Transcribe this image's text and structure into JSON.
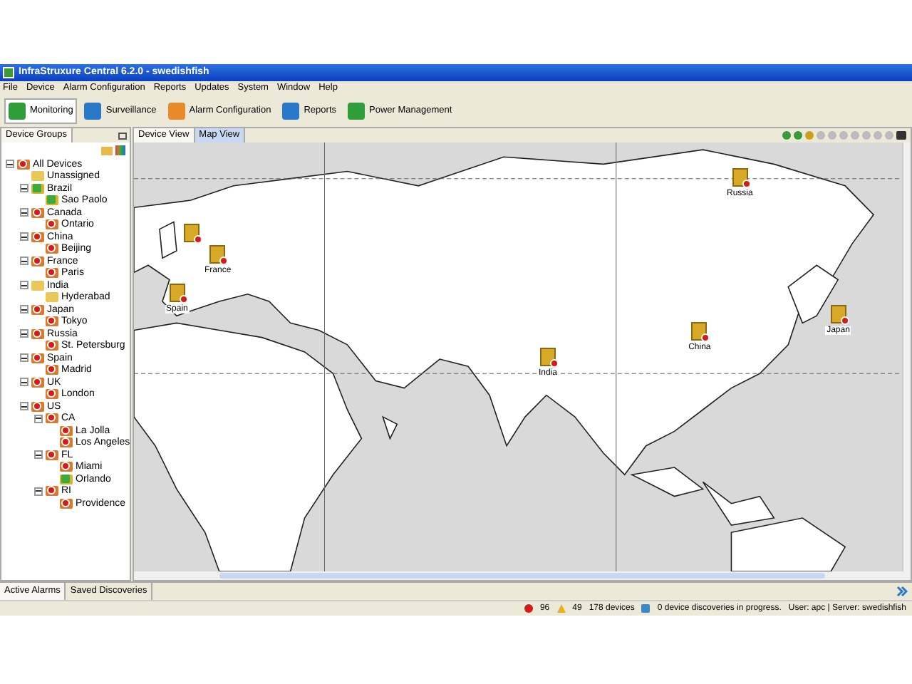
{
  "window": {
    "title": "InfraStruxure Central 6.2.0 - swedishfish"
  },
  "menu": [
    "File",
    "Device",
    "Alarm Configuration",
    "Reports",
    "Updates",
    "System",
    "Window",
    "Help"
  ],
  "toolbar": [
    {
      "label": "Monitoring",
      "selected": true
    },
    {
      "label": "Surveillance",
      "selected": false
    },
    {
      "label": "Alarm Configuration",
      "selected": false
    },
    {
      "label": "Reports",
      "selected": false
    },
    {
      "label": "Power Management",
      "selected": false
    }
  ],
  "left_panel": {
    "tab": "Device Groups",
    "tree": [
      {
        "label": "All Devices",
        "kind": "alarm",
        "expanded": true,
        "children": [
          {
            "label": "Unassigned",
            "kind": "plain"
          },
          {
            "label": "Brazil",
            "kind": "ok",
            "expanded": true,
            "children": [
              {
                "label": "Sao Paolo",
                "kind": "ok"
              }
            ]
          },
          {
            "label": "Canada",
            "kind": "alarm",
            "expanded": true,
            "children": [
              {
                "label": "Ontario",
                "kind": "alarm"
              }
            ]
          },
          {
            "label": "China",
            "kind": "alarm",
            "expanded": true,
            "children": [
              {
                "label": "Beijing",
                "kind": "alarm"
              }
            ]
          },
          {
            "label": "France",
            "kind": "alarm",
            "expanded": true,
            "children": [
              {
                "label": "Paris",
                "kind": "alarm"
              }
            ]
          },
          {
            "label": "India",
            "kind": "plain",
            "expanded": true,
            "children": [
              {
                "label": "Hyderabad",
                "kind": "plain"
              }
            ]
          },
          {
            "label": "Japan",
            "kind": "alarm",
            "expanded": true,
            "children": [
              {
                "label": "Tokyo",
                "kind": "alarm"
              }
            ]
          },
          {
            "label": "Russia",
            "kind": "alarm",
            "expanded": true,
            "children": [
              {
                "label": "St. Petersburg",
                "kind": "alarm"
              }
            ]
          },
          {
            "label": "Spain",
            "kind": "alarm",
            "expanded": true,
            "children": [
              {
                "label": "Madrid",
                "kind": "alarm"
              }
            ]
          },
          {
            "label": "UK",
            "kind": "alarm",
            "expanded": true,
            "children": [
              {
                "label": "London",
                "kind": "alarm"
              }
            ]
          },
          {
            "label": "US",
            "kind": "alarm",
            "expanded": true,
            "children": [
              {
                "label": "CA",
                "kind": "alarm",
                "expanded": true,
                "children": [
                  {
                    "label": "La Jolla",
                    "kind": "alarm"
                  },
                  {
                    "label": "Los Angeles",
                    "kind": "alarm"
                  }
                ]
              },
              {
                "label": "FL",
                "kind": "alarm",
                "expanded": true,
                "children": [
                  {
                    "label": "Miami",
                    "kind": "alarm"
                  },
                  {
                    "label": "Orlando",
                    "kind": "ok"
                  }
                ]
              },
              {
                "label": "RI",
                "kind": "alarm",
                "expanded": true,
                "children": [
                  {
                    "label": "Providence",
                    "kind": "alarm"
                  }
                ]
              }
            ]
          }
        ]
      }
    ]
  },
  "editor_tabs": [
    {
      "label": "Device View",
      "selected": false
    },
    {
      "label": "Map View",
      "selected": true
    }
  ],
  "map": {
    "markers": [
      {
        "label": "Russia",
        "kind": "alarm"
      },
      {
        "kind": "alarm"
      },
      {
        "label": "France",
        "kind": "alarm"
      },
      {
        "label": "Spain",
        "kind": "alarm"
      },
      {
        "label": "India",
        "kind": "alarm"
      },
      {
        "label": "China",
        "kind": "alarm"
      },
      {
        "label": "Japan",
        "kind": "alarm"
      }
    ]
  },
  "bottom_tabs": [
    {
      "label": "Active Alarms",
      "selected": true
    },
    {
      "label": "Saved Discoveries",
      "selected": false
    }
  ],
  "status_bar": {
    "critical": "96",
    "warning": "49",
    "devices": "178 devices",
    "discoveries": "0 device discoveries in progress.",
    "user": "User: apc | Server: swedishfish"
  }
}
